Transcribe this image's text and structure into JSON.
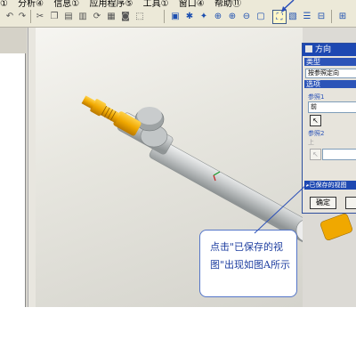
{
  "menubar": {
    "items": [
      "①",
      "分析④",
      "信息①",
      "应用程序⑤",
      "工具①",
      "窗口④",
      "帮助⑪"
    ]
  },
  "dialog": {
    "title": "方向",
    "type_header": "类型",
    "type_value": "按参照定向",
    "options_header": "选项",
    "ref1_label": "参照1",
    "ref1_value": "前",
    "ref2_label": "参照2",
    "ref2_value": "上",
    "saved_views_label": "已保存的视图",
    "ok_label": "确定"
  },
  "callout": {
    "text": "点击\"已保存的视图\"出现如图A所示"
  },
  "colors": {
    "accent": "#1d48b2",
    "annotation": "#1f3fa0",
    "part_orange": "#f0a800",
    "part_grey": "#b8bcbd"
  }
}
